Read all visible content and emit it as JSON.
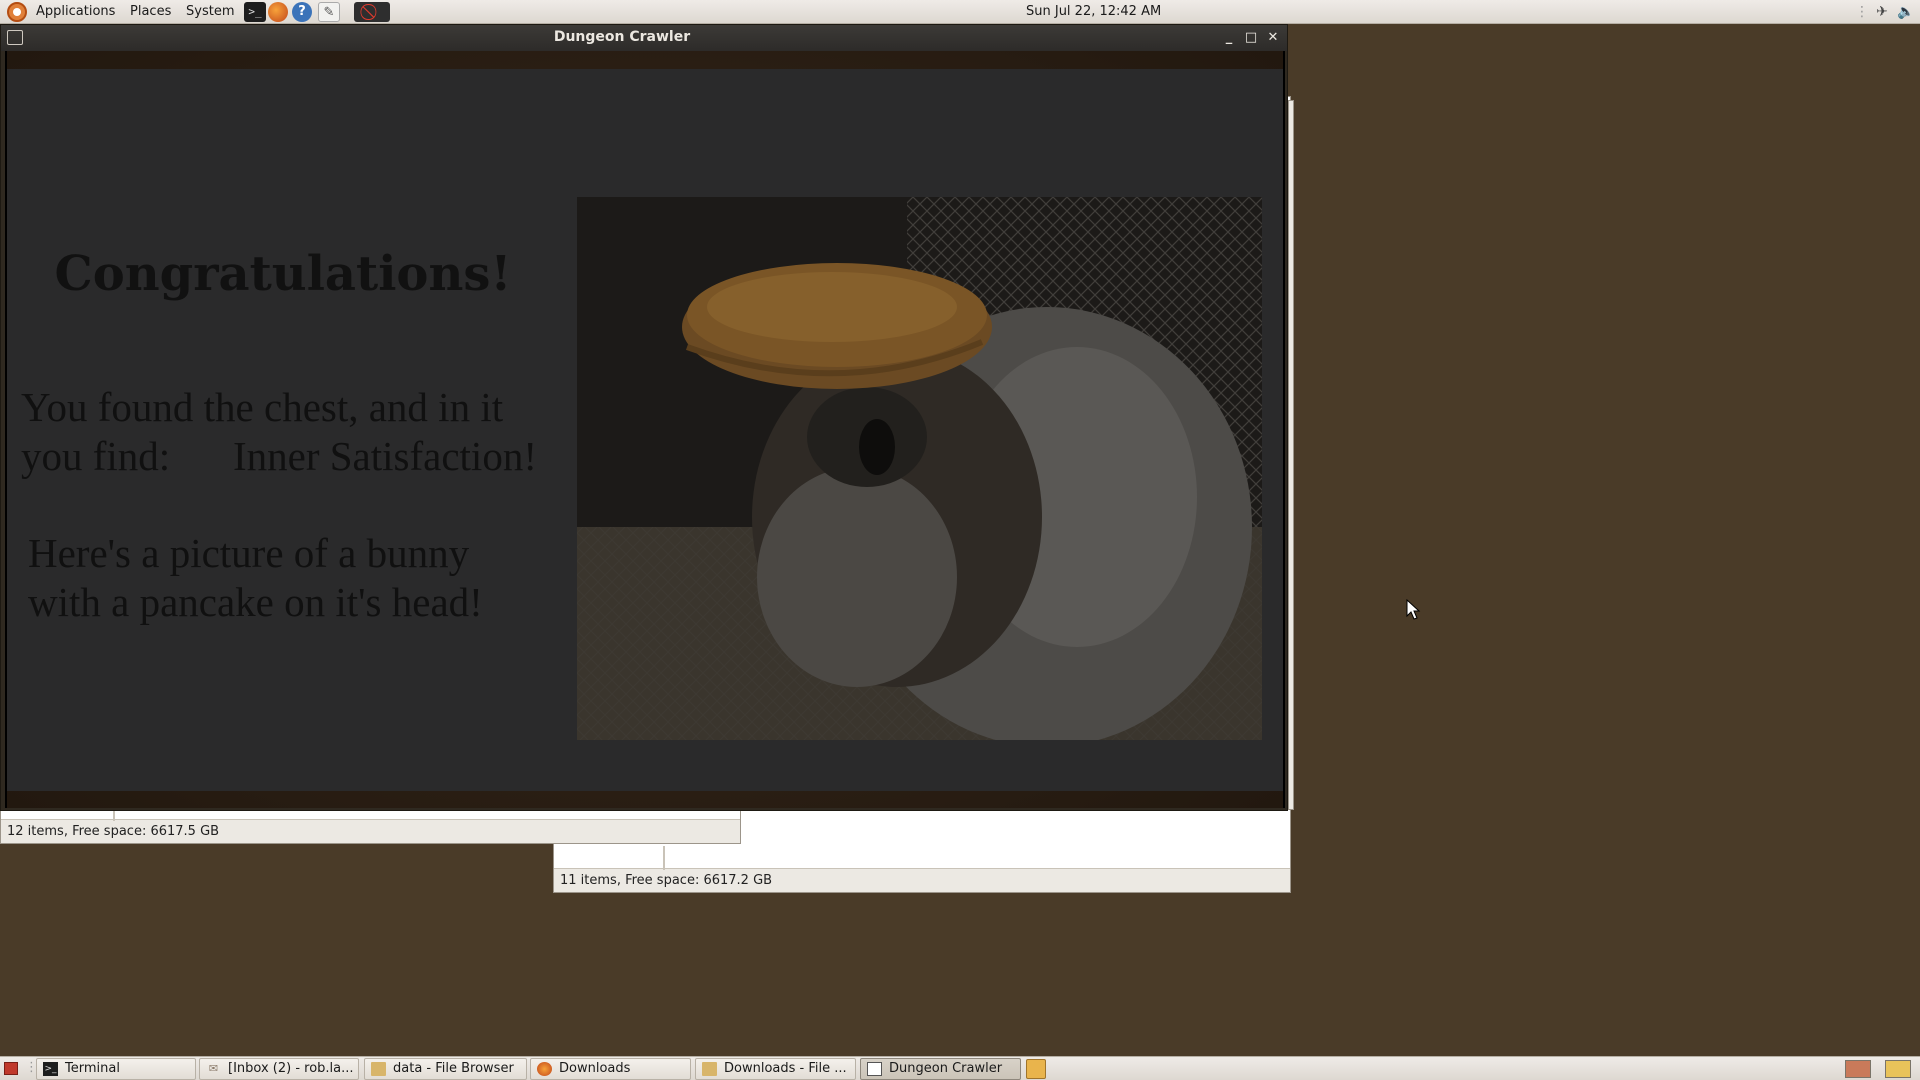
{
  "top_panel": {
    "menus": [
      "Applications",
      "Places",
      "System"
    ],
    "clock": "Sun Jul 22, 12:42 AM",
    "launchers": [
      "terminal-icon",
      "firefox-icon",
      "help-icon",
      "text-editor-icon",
      "no-entry-icon"
    ]
  },
  "window": {
    "title": "Dungeon Crawler",
    "buttons": [
      "minimize",
      "maximize",
      "close"
    ]
  },
  "game": {
    "heading": "Congratulations!",
    "message_line1": "You found the chest, and in it",
    "message_line2_a": "you find:",
    "message_line2_b": "Inner Satisfaction!",
    "message2_line1": "Here's a picture of a bunny",
    "message2_line2": "with a pancake on it's head!",
    "image_name": "bunny-with-pancake-photo"
  },
  "file_windows": [
    {
      "status": "12 items, Free space: 6617.5 GB"
    },
    {
      "status": "11 items, Free space: 6617.2 GB"
    }
  ],
  "taskbar": {
    "tasks": [
      {
        "label": "Terminal",
        "icon": "terminal-icon",
        "active": false
      },
      {
        "label": "[Inbox (2) - rob.la...",
        "icon": "mail-icon",
        "active": false
      },
      {
        "label": "data - File Browser",
        "icon": "folder-icon",
        "active": false
      },
      {
        "label": "Downloads",
        "icon": "firefox-icon",
        "active": false
      },
      {
        "label": "Downloads - File ...",
        "icon": "folder-icon",
        "active": false
      },
      {
        "label": "Dungeon Crawler",
        "icon": "window-icon",
        "active": true
      }
    ]
  },
  "colors": {
    "desktop": "#4a3b28",
    "panel": "#e6e2dc",
    "overlay": "#2a2a2b"
  }
}
